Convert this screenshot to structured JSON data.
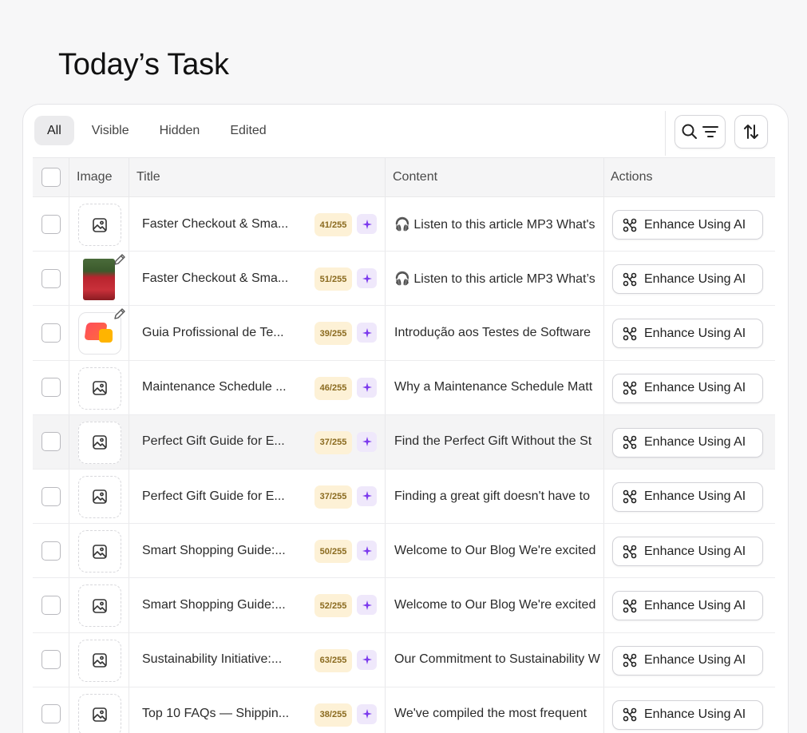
{
  "page": {
    "title": "Today’s Task"
  },
  "tabs": [
    {
      "label": "All",
      "active": true
    },
    {
      "label": "Visible",
      "active": false
    },
    {
      "label": "Hidden",
      "active": false
    },
    {
      "label": "Edited",
      "active": false
    }
  ],
  "table": {
    "headers": {
      "image": "Image",
      "title": "Title",
      "content": "Content",
      "actions": "Actions"
    },
    "action_label": "Enhance Using AI",
    "rows": [
      {
        "image": "placeholder",
        "title": "Faster Checkout & Sma...",
        "count": "41/255",
        "content": "🎧 Listen to this article MP3 What's"
      },
      {
        "image": "photo",
        "title": "Faster Checkout & Sma...",
        "count": "51/255",
        "content": "🎧 Listen to this article MP3 What’s"
      },
      {
        "image": "logo",
        "title": "Guia Profissional de Te...",
        "count": "39/255",
        "content": "Introdução aos Testes de Software"
      },
      {
        "image": "placeholder",
        "title": "Maintenance Schedule ...",
        "count": "46/255",
        "content": "Why a Maintenance Schedule Matt"
      },
      {
        "image": "placeholder",
        "title": "Perfect Gift Guide for E...",
        "count": "37/255",
        "content": "Find the Perfect Gift Without the St"
      },
      {
        "image": "placeholder",
        "title": "Perfect Gift Guide for E...",
        "count": "37/255",
        "content": "Finding a great gift doesn't have to"
      },
      {
        "image": "placeholder",
        "title": "Smart Shopping Guide:...",
        "count": "50/255",
        "content": "Welcome to Our Blog We're excited"
      },
      {
        "image": "placeholder",
        "title": "Smart Shopping Guide:...",
        "count": "52/255",
        "content": "Welcome to Our Blog We're excited"
      },
      {
        "image": "placeholder",
        "title": "Sustainability Initiative:...",
        "count": "63/255",
        "content": "Our Commitment to Sustainability W"
      },
      {
        "image": "placeholder",
        "title": "Top 10 FAQs — Shippin...",
        "count": "38/255",
        "content": "We've compiled the most frequent"
      }
    ]
  },
  "colors": {
    "accent": "#7c3aed",
    "badge_bg": "#fdf1d6",
    "badge_text": "#8a6a1f"
  }
}
